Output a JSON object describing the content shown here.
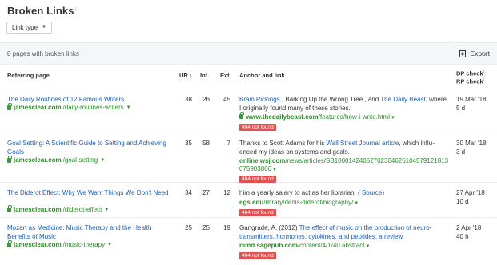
{
  "page": {
    "title": "Broken Links",
    "title_sup": "i",
    "link_type_label": "Link type",
    "summary": "8 pages with broken links",
    "export_label": "Export"
  },
  "columns": {
    "referring_page": "Referring page",
    "ur": "UR",
    "ur_sort": "↓",
    "int": "Int.",
    "ext": "Ext.",
    "anchor": "Anchor and link",
    "dp_check": "DP check",
    "rp_check": "RP check",
    "info_mark": "i"
  },
  "rows": [
    {
      "ref_title": "The Daily Routines of 12 Famous Writers",
      "ref_domain": "jamesclear.com",
      "ref_path": "/daily-routines-writers",
      "ur": "38",
      "int": "26",
      "ext": "45",
      "anchor_parts": [
        {
          "text": "Brain Pickings",
          "link": true
        },
        {
          "text": " , Barking Up the Wrong Tree , and ",
          "link": false
        },
        {
          "text": "The Daily Beast",
          "link": true
        },
        {
          "text": ", where I originally found many of these stories.",
          "link": false
        }
      ],
      "target_domain": "www.thedailybeast.com",
      "target_path": "/features/how-i-write.html",
      "status": "404 not found",
      "dp": "19 Mar '18",
      "rp": "5 d"
    },
    {
      "ref_title": "Goal Setting: A Scientific Guide to Setting and Achieving Goals",
      "ref_domain": "jamesclear.com",
      "ref_path": "/goal-setting",
      "ur": "35",
      "int": "58",
      "ext": "7",
      "anchor_parts": [
        {
          "text": "Thanks to Scott Adams for his ",
          "link": false
        },
        {
          "text": "Wall Street Journal article",
          "link": true
        },
        {
          "text": ", which influ-enced my ideas on systems and goals.",
          "link": false
        }
      ],
      "target_domain": "online.wsj.com",
      "target_path": "/news/articles/SB10001424052702304626104579121813075903866",
      "status": "404 not found",
      "dp": "30 Mar '18",
      "rp": "3 d"
    },
    {
      "ref_title": "The Diderot Effect: Why We Want Things We Don't Need",
      "ref_domain": "jamesclear.com",
      "ref_path": "/diderot-effect",
      "ur": "34",
      "int": "27",
      "ext": "12",
      "anchor_parts": [
        {
          "text": "him a yearly salary to act as her librarian. ( ",
          "link": false
        },
        {
          "text": "Source",
          "link": true
        },
        {
          "text": ")",
          "link": false
        }
      ],
      "target_domain": "egs.edu",
      "target_path": "/library/denis-diderot/biography/",
      "status": "404 not found",
      "dp": "27 Apr '18",
      "rp": "10 d"
    },
    {
      "ref_title": "Mozart as Medicine: Music Therapy and the Health Benefits of Music",
      "ref_domain": "jamesclear.com",
      "ref_path": "/music-therapy",
      "ur": "25",
      "int": "25",
      "ext": "19",
      "anchor_parts": [
        {
          "text": "Gangrade, A. (2012) ",
          "link": false
        },
        {
          "text": "The effect of music on the production of neuro-transmitters, hormones, cytokines, and peptides: a review.",
          "link": true
        }
      ],
      "target_domain": "mmd.sagepub.com",
      "target_path": "/content/4/1/40.abstract",
      "status": "404 not found",
      "dp": "2 Apr '18",
      "rp": "40 h"
    }
  ],
  "colors": {
    "link": "#1a5fb4",
    "url_green": "#2e8b2e",
    "badge_red": "#e05252"
  }
}
